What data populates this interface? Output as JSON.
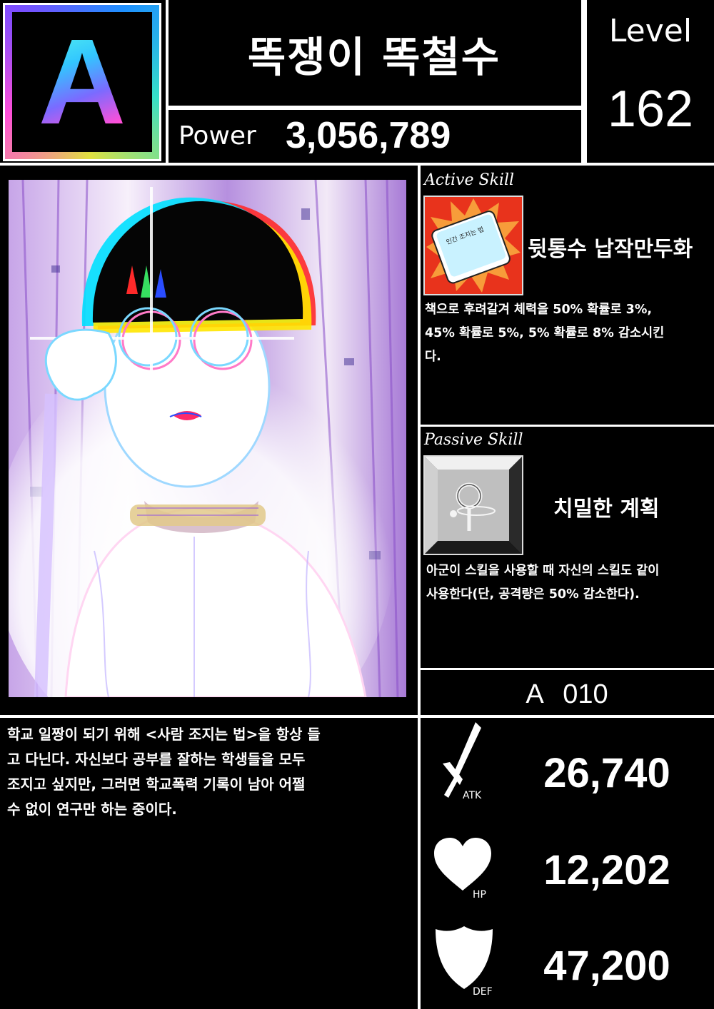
{
  "card": {
    "rank": "A",
    "name": "똑쟁이 똑철수",
    "power_label": "Power",
    "power": "3,056,789",
    "level_label": "Level",
    "level": "162",
    "card_id": "A 010"
  },
  "active_skill": {
    "title": "Active Skill",
    "icon": "book-icon",
    "book_text": "인간 조지는 법",
    "name": "뒷통수 납작만두화",
    "desc_lines": [
      "책으로 후려갈겨 체력을 50% 확률로 3%,",
      "45% 확률로 5%, 5% 확률로 8% 감소시킨",
      "다."
    ]
  },
  "passive_skill": {
    "title": "Passive Skill",
    "icon": "magnifier-icon",
    "name": "치밀한 계획",
    "desc_lines": [
      "아군이 스킬을 사용할 때 자신의 스킬도 같이",
      "사용한다(단, 공격량은 50% 감소한다)."
    ]
  },
  "bio_lines": [
    "학교 일짱이 되기 위해 <사람 조지는 법>을 항상 들",
    "고 다닌다. 자신보다 공부를 잘하는 학생들을 모두",
    "조지고 싶지만, 그러면 학교폭력 기록이 남아 어쩔",
    "수 없이 연구만 하는 중이다."
  ],
  "stats": {
    "atk": {
      "label": "ATK",
      "value": "26,740",
      "icon": "sword-icon"
    },
    "hp": {
      "label": "HP",
      "value": "12,202",
      "icon": "heart-icon"
    },
    "def": {
      "label": "DEF",
      "value": "47,200",
      "icon": "shield-icon"
    }
  },
  "colors": {
    "background": "#000000",
    "border": "#ffffff",
    "rank_gradient": [
      "#5fffe8",
      "#32c6ff",
      "#7a6bff",
      "#ff4fd8"
    ],
    "skill_burst": "#e8341c"
  }
}
